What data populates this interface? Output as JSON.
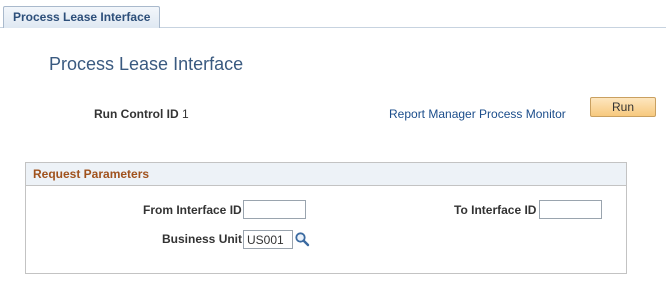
{
  "tab": {
    "label": "Process Lease Interface"
  },
  "page": {
    "title": "Process Lease Interface"
  },
  "run_control": {
    "label": "Run Control ID",
    "value": "1"
  },
  "links": {
    "report_manager_process_monitor": "Report Manager Process Monitor"
  },
  "buttons": {
    "run": "Run"
  },
  "request_parameters": {
    "title": "Request Parameters",
    "from_interface_id": {
      "label": "From Interface ID",
      "value": ""
    },
    "to_interface_id": {
      "label": "To Interface ID",
      "value": ""
    },
    "business_unit": {
      "label": "Business Unit",
      "value": "US001",
      "lookup_icon": "magnifier-icon"
    }
  },
  "colors": {
    "tab_text": "#2d4f7a",
    "title_text": "#3a5a80",
    "link": "#1b4d8b",
    "group_header_text": "#a0521d",
    "button_bg": "#f7c97e"
  }
}
